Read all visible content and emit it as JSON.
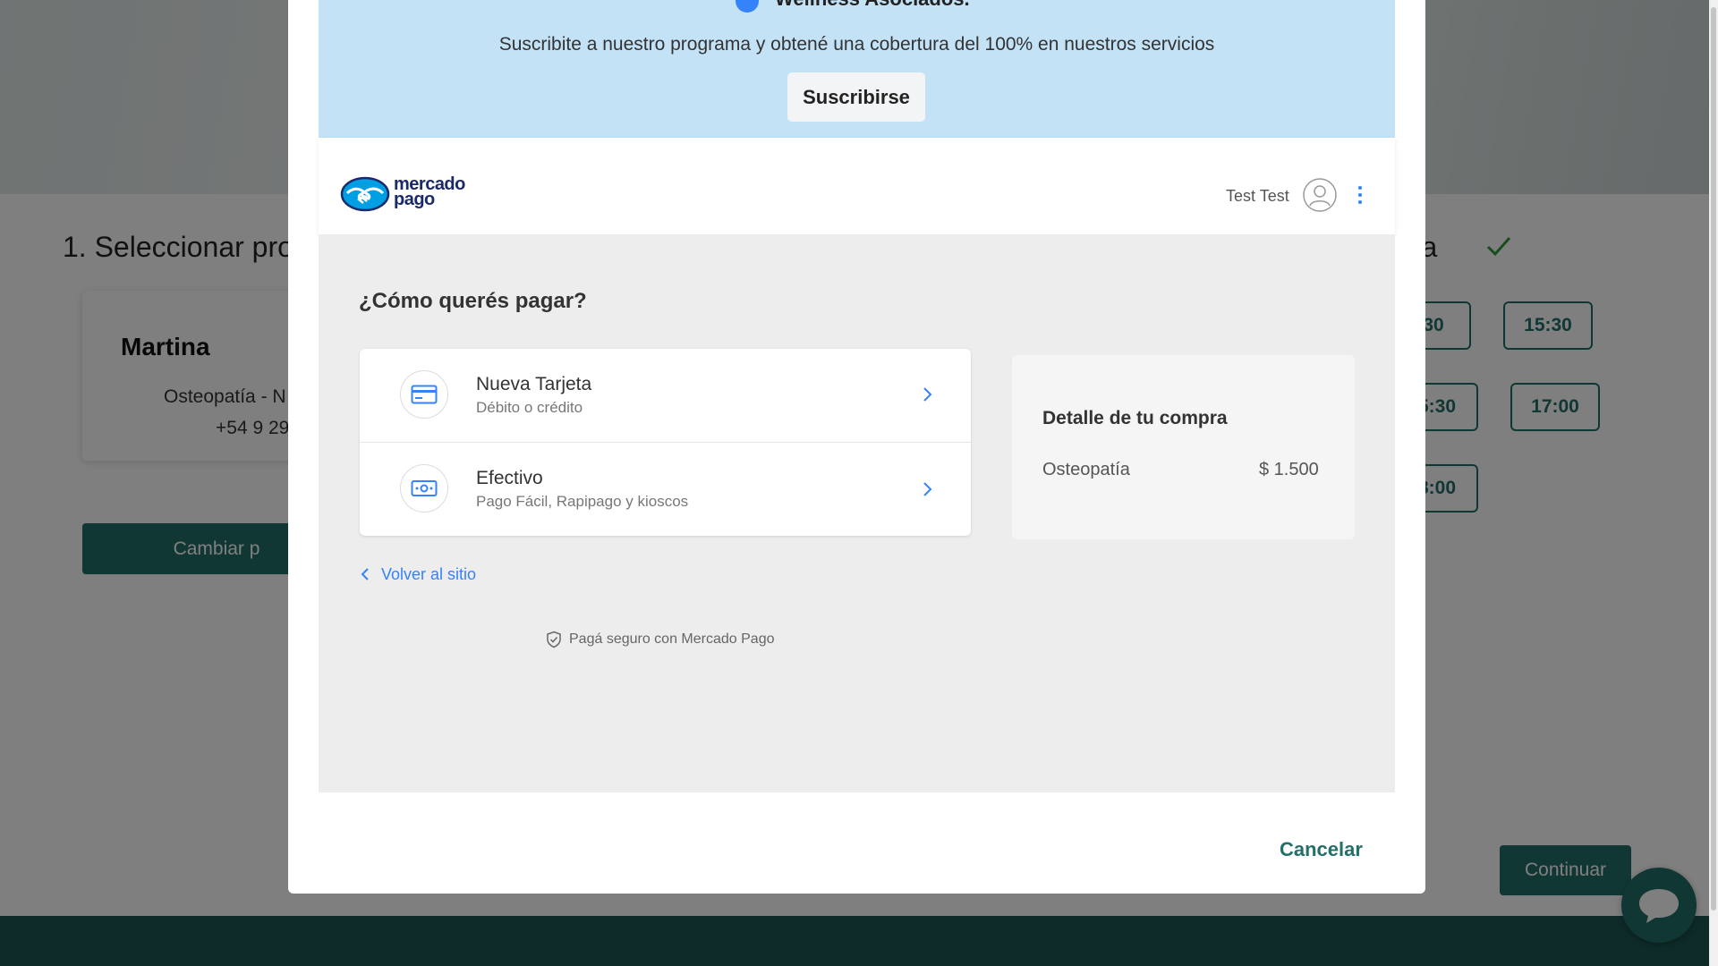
{
  "background_page": {
    "step1_title": "1. Seleccionar pro",
    "step2_title_fragment": "ora",
    "professional": {
      "name": "Martina",
      "specialty": "Osteopatía - N",
      "phone": "+54 9 29"
    },
    "change_button_label": "Cambiar p",
    "time_slots": [
      "30",
      "15:30",
      "5:30",
      "17:00",
      "8:00"
    ],
    "continue_button_label": "Continuar"
  },
  "promo": {
    "heading": "Wellness Asociados.",
    "text": "Suscribite a nuestro programa y obtené una cobertura del 100% en nuestros servicios",
    "subscribe_button_label": "Suscribirse"
  },
  "mercadopago": {
    "logo_line1": "mercado",
    "logo_line2": "pago",
    "user_name": "Test Test",
    "question": "¿Cómo querés pagar?",
    "methods": [
      {
        "title": "Nueva Tarjeta",
        "subtitle": "Débito o crédito",
        "icon": "credit-card-icon"
      },
      {
        "title": "Efectivo",
        "subtitle": "Pago Fácil, Rapipago y kioscos",
        "icon": "cash-icon"
      }
    ],
    "back_link": "Volver al sitio",
    "secure_text": "Pagá seguro con Mercado Pago",
    "summary": {
      "title": "Detalle de tu compra",
      "item": "Osteopatía",
      "price": "$ 1.500"
    }
  },
  "modal": {
    "cancel_label": "Cancelar"
  },
  "colors": {
    "brand_teal": "#236f6a",
    "mp_blue": "#3483fa",
    "promo_bg": "#c3e2f6"
  }
}
